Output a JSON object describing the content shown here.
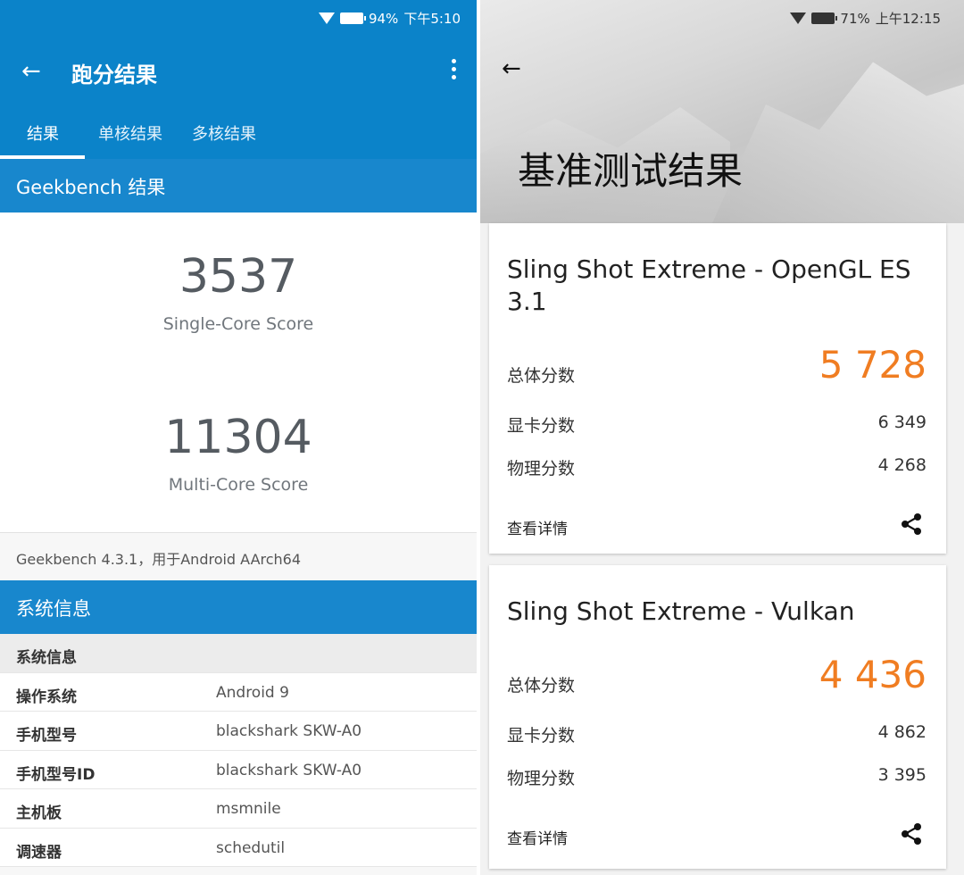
{
  "left": {
    "status": {
      "battery": "94%",
      "time": "下午5:10"
    },
    "appbar": {
      "title": "跑分结果"
    },
    "tabs": [
      {
        "label": "结果"
      },
      {
        "label": "单核结果"
      },
      {
        "label": "多核结果"
      }
    ],
    "section_title": "Geekbench 结果",
    "single_core": {
      "score": "3537",
      "label": "Single-Core Score"
    },
    "multi_core": {
      "score": "11304",
      "label": "Multi-Core Score"
    },
    "version": "Geekbench 4.3.1，用于Android AArch64",
    "sys_section_title": "系统信息",
    "sys_table_header": "系统信息",
    "sys_rows": [
      {
        "k": "操作系统",
        "v": "Android 9"
      },
      {
        "k": "手机型号",
        "v": "blackshark SKW-A0"
      },
      {
        "k": "手机型号ID",
        "v": "blackshark SKW-A0"
      },
      {
        "k": "主机板",
        "v": "msmnile"
      },
      {
        "k": "调速器",
        "v": "schedutil"
      }
    ]
  },
  "right": {
    "status": {
      "battery": "71%",
      "time": "上午12:15"
    },
    "hero_title": "基准测试结果",
    "cards": [
      {
        "title": "Sling Shot Extreme - OpenGL ES 3.1",
        "total_label": "总体分数",
        "total": "5 728",
        "gpu_label": "显卡分数",
        "gpu": "6 349",
        "physics_label": "物理分数",
        "physics": "4 268",
        "details": "查看详情"
      },
      {
        "title": "Sling Shot Extreme - Vulkan",
        "total_label": "总体分数",
        "total": "4 436",
        "gpu_label": "显卡分数",
        "gpu": "4 862",
        "physics_label": "物理分数",
        "physics": "3 395",
        "details": "查看详情"
      }
    ],
    "accent_color": "#f07d22"
  },
  "colors": {
    "primary": "#0b83c9",
    "section": "#1887cd"
  }
}
